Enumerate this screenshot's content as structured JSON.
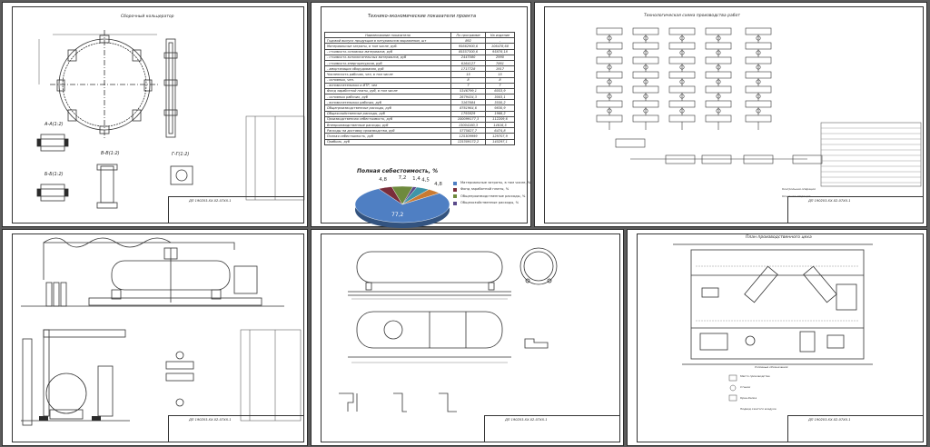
{
  "sheets": {
    "s1": {
      "title": "Сборочный кольцератор",
      "code": "ДП 190203.ХХ-02-07ХХ.1",
      "views": [
        "А-А(1:2)",
        "Б-Б(1:2)",
        "В-В(1:2)",
        "Г-Г(1:2)"
      ]
    },
    "s2": {
      "title": "Технико-экономические показатели проекта",
      "code": "ДП 190203.ХХ-02-07ХХ.1"
    },
    "s3": {
      "title": "Технологическая схема производства работ",
      "code": "ДП 190203.ХХ-02-07ХХ.1"
    },
    "s4": {
      "code": "ДП 190203.ХХ-02-07ХХ.1"
    },
    "s5": {
      "code": "ДП 190203.ХХ-02-07ХХ.1"
    },
    "s6": {
      "title": "План производственного цеха",
      "code": "ДП 190203.ХХ-02-07ХХ.1"
    }
  },
  "tep_table": {
    "headers": [
      "Наименование показателя",
      "По программе",
      "На изделие"
    ],
    "rows": [
      [
        "Годовой выпуск продукции в натуральном выражении, шт",
        "892",
        "-"
      ],
      [
        "Материальные затраты, в том числе, руб.",
        "95662900,6",
        "106478,68"
      ],
      [
        "- стоимость основных материалов, руб",
        "85557300,6",
        "95878,18"
      ],
      [
        "- стоимость вспомогательных материалов, руб",
        "2447080",
        "2990"
      ],
      [
        "- стоимость энергоресурсов, руб",
        "6164127",
        "7861"
      ],
      [
        "- амортизация оборудования, руб",
        "1717728",
        "1917"
      ],
      [
        "Численность рабочих, чел, в том числе",
        "15",
        "15"
      ],
      [
        "- основных, чел.",
        "8",
        "8"
      ],
      [
        "- вспомогательных и ИТР, чел",
        "7",
        "7"
      ],
      [
        "Фонд заработной платы, руб, в том числе",
        "5346799,1",
        "6053,9"
      ],
      [
        "- основных рабочих, руб",
        "2679434,3",
        "3003,1"
      ],
      [
        "- вспомогательных рабочих, руб",
        "3167684",
        "3550,2"
      ],
      [
        "Общепроизводственные расходы, руб",
        "8761964,6",
        "9830,9"
      ],
      [
        "Общехозяйственные расходы, руб",
        "1793829",
        "1966,2"
      ],
      [
        "Производственная себестоимость, руб",
        "100099177,3",
        "112209,6"
      ],
      [
        "Внепроизводственные расходы, руб",
        "13004160,3",
        "14616,5"
      ],
      [
        "Расходы на доставку производства, руб",
        "5775827,7",
        "6474,8"
      ],
      [
        "Полная себестоимость, руб",
        "125309999",
        "129707,9"
      ],
      [
        "Прибыль, руб",
        "125309172,2",
        "140297,1"
      ]
    ]
  },
  "chart_data": {
    "type": "pie",
    "title": "Полная себестоимость, %",
    "labels": [
      "Материальные затраты, в том числе, %",
      "Фонд заработной платы, %",
      "Общепроизводственные расходы, %",
      "Общехозяйственные расходы, %"
    ],
    "values": [
      77.2,
      4.8,
      7.2,
      1.4,
      4.5,
      4.8
    ],
    "value_labels": [
      "77,2",
      "4,8",
      "7,2",
      "1,4",
      "4,5",
      "4,8"
    ],
    "colors": [
      "#4f7fc3",
      "#7a2d3a",
      "#6e8a3d",
      "#5a4a8a",
      "#3f95a8",
      "#c97a32"
    ]
  },
  "legend_swatch_colors": [
    "#4f7fc3",
    "#7a2d3a",
    "#6e8a3d",
    "#5a4a8a"
  ],
  "s6_notes": {
    "heading": "Условные обозначения",
    "items": [
      "Место производства",
      "Станок",
      "Кран-балка",
      "Подвод сжатого воздуха"
    ]
  },
  "s3_legend": [
    "Контрольная операция",
    "Основная операция"
  ]
}
